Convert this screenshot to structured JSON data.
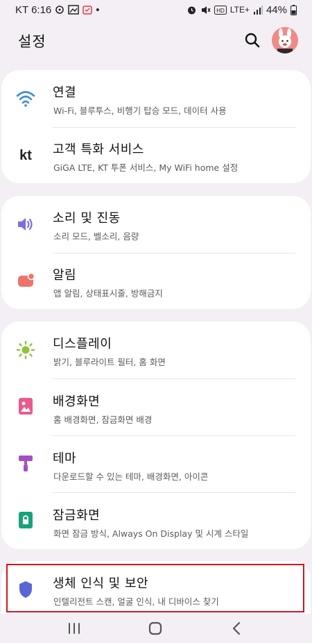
{
  "status_bar": {
    "carrier_time": "KT 6:16",
    "dot": "•",
    "network": "LTE+",
    "battery": "44%"
  },
  "header": {
    "title": "설정",
    "search_icon": "search-icon",
    "avatar_icon": "rabbit-avatar"
  },
  "colors": {
    "wifi": "#3d8be0",
    "kt": "#222222",
    "sound": "#7b6de0",
    "notification": "#f0736a",
    "display": "#8fc43a",
    "wallpaper": "#e85b8e",
    "theme": "#a64fc4",
    "lockscreen": "#1aa27c",
    "security": "#5a66d6",
    "highlight": "#d4141c"
  },
  "groups": [
    {
      "items": [
        {
          "icon": "wifi-icon",
          "title": "연결",
          "subtitle": "Wi-Fi, 블루투스, 비행기 탑승 모드, 데이터 사용"
        },
        {
          "icon": "kt-icon",
          "title": "고객 특화 서비스",
          "subtitle": "GiGA LTE, KT 투폰 서비스, My WiFi home 설정"
        }
      ]
    },
    {
      "items": [
        {
          "icon": "speaker-icon",
          "title": "소리 및 진동",
          "subtitle": "소리 모드, 벨소리, 음량"
        },
        {
          "icon": "notification-icon",
          "title": "알림",
          "subtitle": "앱 알림, 상태표시줄, 방해금지"
        }
      ]
    },
    {
      "items": [
        {
          "icon": "brightness-icon",
          "title": "디스플레이",
          "subtitle": "밝기, 블루라이트 필터, 홈 화면"
        },
        {
          "icon": "wallpaper-icon",
          "title": "배경화면",
          "subtitle": "홈 배경화면, 잠금화면 배경"
        },
        {
          "icon": "theme-brush-icon",
          "title": "테마",
          "subtitle": "다운로드할 수 있는 테마, 배경화면, 아이콘"
        },
        {
          "icon": "lock-icon",
          "title": "잠금화면",
          "subtitle": "화면 잠금 방식, Always On Display 및 시계 스타일"
        }
      ]
    },
    {
      "items": [
        {
          "icon": "shield-icon",
          "title": "생체 인식 및 보안",
          "subtitle": "인텔리전트 스캔, 얼굴 인식, 내 디바이스 찾기"
        }
      ]
    }
  ],
  "nav_bar": {
    "recents_icon": "recents-icon",
    "home_icon": "home-icon",
    "back_icon": "back-icon"
  }
}
